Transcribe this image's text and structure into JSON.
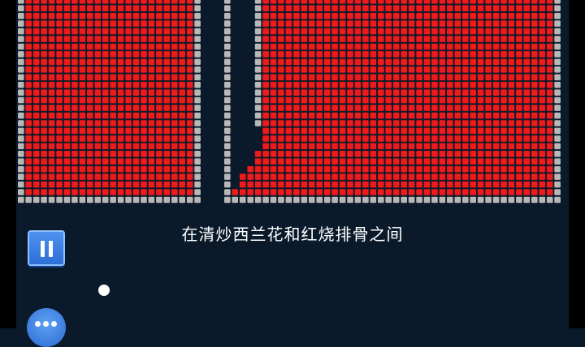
{
  "subtitle": "在清炒西兰花和红烧排骨之间",
  "controls": {
    "pause": "pause",
    "menu": "more"
  },
  "icons": {
    "pause": "pause-icon",
    "menu": "more-dots-icon",
    "ball": "ball"
  },
  "colors": {
    "background": "#0b1a2b",
    "brick_filled": "#f11a1a",
    "brick_empty": "#b8b8b8",
    "button_blue": "#3b7fe4"
  }
}
